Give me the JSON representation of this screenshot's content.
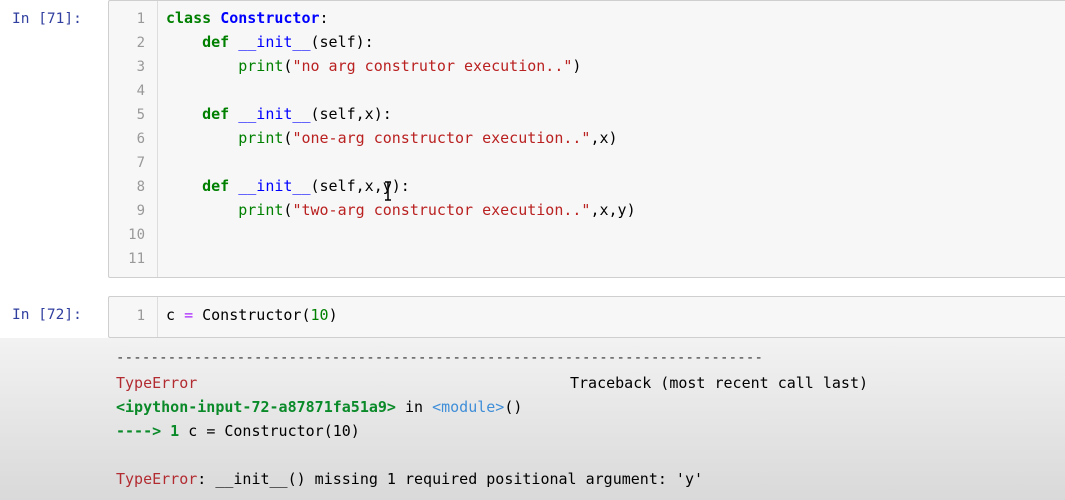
{
  "cells": [
    {
      "prompt": "In [71]:",
      "line_numbers": [
        "1",
        "2",
        "3",
        "4",
        "5",
        "6",
        "7",
        "8",
        "9",
        "10",
        "11"
      ],
      "code": {
        "l1_kw": "class",
        "l1_name": "Constructor",
        "l1_colon": ":",
        "def": "def",
        "init": "__init__",
        "l2_args": "(self):",
        "print": "print",
        "l3_open": "(",
        "l3_str": "\"no arg construtor execution..\"",
        "l3_close": ")",
        "l5_args": "(self,x):",
        "l6_str": "\"one-arg constructor execution..\"",
        "l6_rest": ",x)",
        "l8_args": "(self,x,y):",
        "l9_str": "\"two-arg constructor execution..\"",
        "l9_rest": ",x,y)"
      }
    },
    {
      "prompt": "In [72]:",
      "line_numbers": [
        "1"
      ],
      "code": {
        "var": "c",
        "eq": "=",
        "call": "Constructor",
        "open": "(",
        "arg": "10",
        "close": ")"
      }
    }
  ],
  "output": {
    "dashes": "---------------------------------------------------------------------------",
    "error_name": "TypeError",
    "traceback_label": "Traceback (most recent call last)",
    "input_ref": "<ipython-input-72-a87871fa51a9>",
    "in_word": "in",
    "module_ref": "<module>",
    "module_parens": "()",
    "arrow": "----> 1",
    "arrow_code_var": "c",
    "arrow_code_eq": "=",
    "arrow_code_call": "Constructor",
    "arrow_code_args": "(10)",
    "final_error_name": "TypeError",
    "final_error_msg": ": __init__() missing 1 required positional argument: 'y'"
  }
}
